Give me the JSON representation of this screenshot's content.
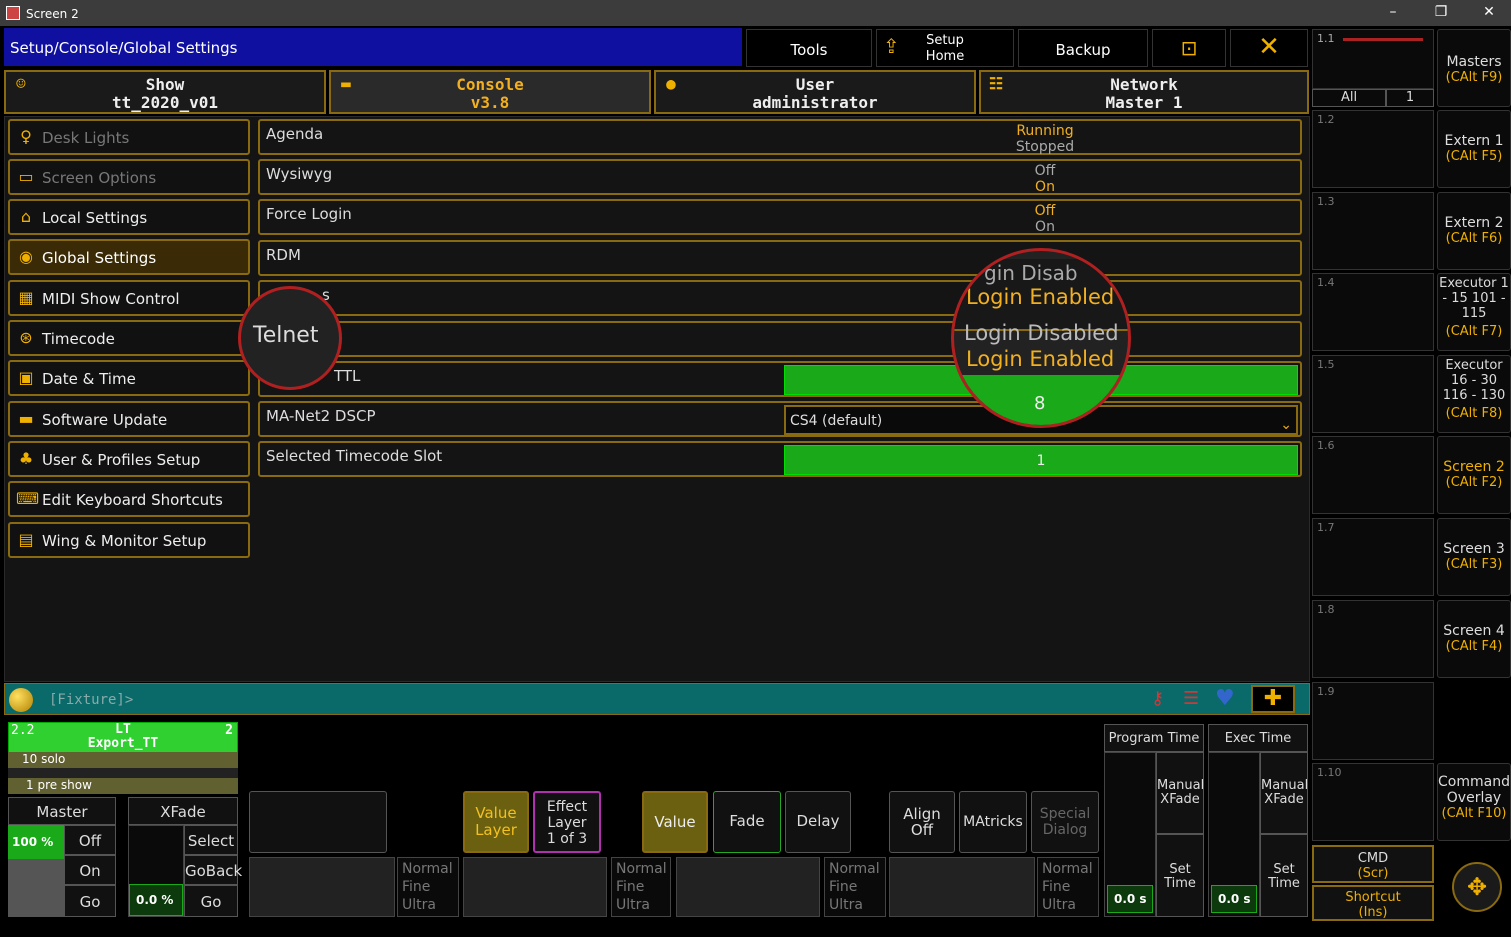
{
  "window": {
    "title": "Screen 2",
    "minimize": "–",
    "restore": "❐",
    "close": "✕"
  },
  "header": {
    "path": "Setup/Console/Global Settings",
    "tools": "Tools",
    "setup_home_1": "Setup",
    "setup_home_2": "Home",
    "backup": "Backup"
  },
  "tabs": [
    {
      "l1": "Show",
      "l2": "tt_2020_v01"
    },
    {
      "l1": "Console",
      "l2": "v3.8"
    },
    {
      "l1": "User",
      "l2": "administrator"
    },
    {
      "l1": "Network",
      "l2": "Master 1"
    }
  ],
  "sidebar": [
    {
      "label": "Desk Lights",
      "icon": "bulb-icon"
    },
    {
      "label": "Screen Options",
      "icon": "monitor-icon"
    },
    {
      "label": "Local Settings",
      "icon": "home-icon"
    },
    {
      "label": "Global Settings",
      "icon": "globe-icon"
    },
    {
      "label": "MIDI Show Control",
      "icon": "midi-icon"
    },
    {
      "label": "Timecode",
      "icon": "timecode-icon"
    },
    {
      "label": "Date & Time",
      "icon": "calendar-icon"
    },
    {
      "label": "Software Update",
      "icon": "update-icon"
    },
    {
      "label": "User & Profiles Setup",
      "icon": "users-icon"
    },
    {
      "label": "Edit Keyboard Shortcuts",
      "icon": "keyboard-icon"
    },
    {
      "label": "Wing & Monitor Setup",
      "icon": "monitor-setup-icon"
    }
  ],
  "settings": {
    "agenda": {
      "label": "Agenda",
      "v1": "Running",
      "v2": "Stopped"
    },
    "wysiwyg": {
      "label": "Wysiwyg",
      "v1": "Off",
      "v2": "On"
    },
    "force_login": {
      "label": "Force Login",
      "v1": "Off",
      "v2": "On"
    },
    "rdm": {
      "label": "RDM"
    },
    "row5": {
      "label": "s"
    },
    "ttl": {
      "label": "TTL"
    },
    "dscp": {
      "label": "MA-Net2 DSCP",
      "value": "CS4 (default)"
    },
    "timecode_slot": {
      "label": "Selected Timecode Slot",
      "value": "1"
    }
  },
  "magnifier_left": {
    "text": "Telnet"
  },
  "magnifier_right": {
    "a": "gin Disab",
    "b": "Login Enabled",
    "c": "Login Disabled",
    "d": "Login Enabled",
    "e": "8"
  },
  "fixture_bar": {
    "text": "[Fixture]>"
  },
  "executor": {
    "num": "2.2",
    "page": "2",
    "name1": "LT",
    "name2": "Export_TT",
    "cue1": "10 solo",
    "cue2": "1 pre show"
  },
  "master": {
    "title": "Master",
    "pct": "100 %",
    "off": "Off",
    "on": "On",
    "go": "Go"
  },
  "xfade": {
    "title": "XFade",
    "val": "0.0 %",
    "select": "Select",
    "goback": "GoBack",
    "go": "Go"
  },
  "encoders": {
    "value_layer_1": "Value",
    "value_layer_2": "Layer",
    "effect_1": "Effect",
    "effect_2": "Layer",
    "effect_3": "1 of 3",
    "value": "Value",
    "fade": "Fade",
    "delay": "Delay",
    "align_1": "Align",
    "align_2": "Off",
    "matricks": "MAtricks",
    "special_1": "Special",
    "special_2": "Dialog",
    "normal": "Normal",
    "fine": "Fine",
    "ultra": "Ultra"
  },
  "program_time": {
    "title": "Program Time",
    "manual_1": "Manual",
    "manual_2": "XFade",
    "set_1": "Set",
    "set_2": "Time",
    "val": "0.0 s"
  },
  "exec_time": {
    "title": "Exec Time",
    "manual_1": "Manual",
    "manual_2": "XFade",
    "set_1": "Set",
    "set_2": "Time",
    "val": "0.0 s"
  },
  "right_col": {
    "top_all": "All",
    "top_num": "1",
    "top_label": "1.1",
    "rows": [
      "1.2",
      "1.3",
      "1.4",
      "1.5",
      "1.6",
      "1.7",
      "1.8",
      "1.9",
      "1.10"
    ]
  },
  "right_buttons": [
    {
      "l": "Masters",
      "s": "(CAlt F9)"
    },
    {
      "l": "Extern 1",
      "s": "(CAlt F5)"
    },
    {
      "l": "Extern 2",
      "s": "(CAlt F6)"
    },
    {
      "l": "Executor 1 - 15 101 - 115",
      "s": "(CAlt F7)"
    },
    {
      "l": "Executor 16 - 30 116 - 130",
      "s": "(CAlt F8)"
    },
    {
      "l": "Screen 2",
      "s": "(CAlt F2)"
    },
    {
      "l": "Screen 3",
      "s": "(CAlt F3)"
    },
    {
      "l": "Screen 4",
      "s": "(CAlt F4)"
    },
    {
      "l": "Command Overlay",
      "s": "(CAlt F10)"
    }
  ],
  "cmd": {
    "l": "CMD",
    "s": "(Scr)"
  },
  "shortcut": {
    "l": "Shortcut",
    "s": "(Ins)"
  }
}
